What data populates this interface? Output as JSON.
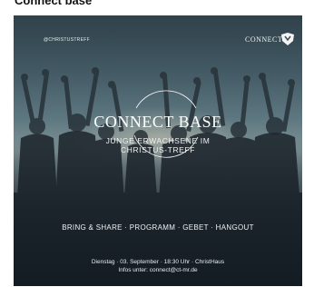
{
  "page": {
    "title": "Connect base"
  },
  "poster": {
    "handle": "@CHRISTUSTREFF",
    "connect_label": "CONNECT",
    "title": "CONNECT BASE",
    "subtitle_line1": "JUNGE ERWACHSENE IM",
    "subtitle_line2": "CHRISTUS-TREFF",
    "tags": "BRING & SHARE · PROGRAMM · GEBET · HANGOUT",
    "info_line1": "Dienstag · 03. September · 18:30 Uhr · ChristHaus",
    "info_line2": "Infos unter: connect@ct-mr.de"
  },
  "colors": {
    "sky": "#8fa5a8",
    "dark": "#2c3740",
    "text": "#ffffff"
  },
  "icons": {
    "logo": "christus-treff-logo"
  }
}
